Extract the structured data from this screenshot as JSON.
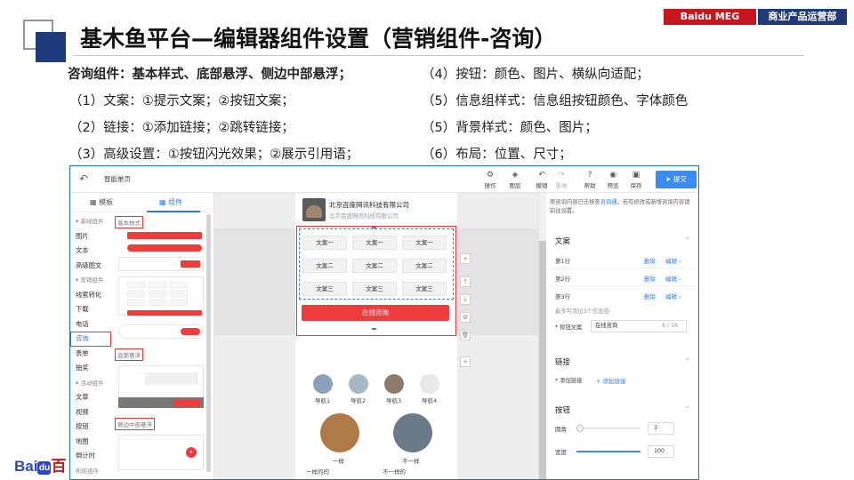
{
  "header": {
    "title": "基木鱼平台—编辑器组件设置（营销组件-咨询）",
    "tag_left": "Baidu MEG",
    "tag_right": "商业产品运营部"
  },
  "bullets": {
    "left": [
      "咨询组件：基本样式、底部悬浮、侧边中部悬浮；",
      "（1）文案：①提示文案；②按钮文案；",
      "（2）链接：①添加链接；②跳转链接；",
      "（3）高级设置：①按钮闪光效果；②展示引用语；"
    ],
    "right": [
      "（4）按钮：颜色、图片、横纵向适配；",
      "（5）信息组样式：信息组按钮颜色、字体颜色",
      "（5）背景样式：颜色、图片；",
      "（6）布局：位置、尺寸；"
    ]
  },
  "logo": {
    "left": "Bai",
    "mid": "du",
    "right": "百"
  },
  "editor": {
    "page_name": "智能单页",
    "toolbar": {
      "operate": "操作",
      "layer": "图层",
      "undo": "撤销",
      "redo": "重做",
      "help": "帮助",
      "preview": "预览",
      "save": "保存",
      "submit": "提交"
    },
    "left_panel": {
      "tab_template": "模板",
      "tab_component": "组件",
      "nav": [
        {
          "label": "基础组件",
          "group": true
        },
        {
          "label": "图片"
        },
        {
          "label": "文本"
        },
        {
          "label": "高级图文"
        },
        {
          "label": "营销组件",
          "group": true
        },
        {
          "label": "线索转化"
        },
        {
          "label": "下载"
        },
        {
          "label": "电话"
        },
        {
          "label": "咨询",
          "selected": true
        },
        {
          "label": "表单"
        },
        {
          "label": "抽奖"
        },
        {
          "label": "活动组件",
          "group": true
        },
        {
          "label": "文章"
        },
        {
          "label": "视频"
        },
        {
          "label": "按钮"
        },
        {
          "label": "地图"
        },
        {
          "label": "倒计时"
        },
        {
          "label": "布局组件",
          "group": true
        }
      ],
      "preview_labels": {
        "basic": "基本样式",
        "bottom": "底部悬浮",
        "side": "侧边中部悬浮"
      }
    },
    "phone": {
      "company": "北京百度网讯科技有限公司",
      "company_sub": "北京百度网讯科技有限公司",
      "grid": [
        [
          "文案一",
          "文案一",
          "文案一"
        ],
        [
          "文案二",
          "文案二",
          "文案二"
        ],
        [
          "文案三",
          "文案三",
          "文案三"
        ]
      ],
      "online_button": "在线咨询",
      "nav_items": [
        "导航1",
        "导航2",
        "导航3",
        "导航4"
      ],
      "big_items": [
        "一样",
        "不一样"
      ],
      "big_subs": [
        "一样的的",
        "不一样的"
      ],
      "phone_label": "电话",
      "consult_label": "咨询"
    },
    "right_panel": {
      "tip_prefix": "原咨询内容已迁移至",
      "tip_link": "咨询通",
      "tip_suffix": "，若有修改或新增咨询内容请前往设置。",
      "copy_section": "文案",
      "rows": [
        {
          "label": "第1行",
          "delete": "删除",
          "edit": "编辑"
        },
        {
          "label": "第2行",
          "delete": "删除",
          "edit": "编辑"
        },
        {
          "label": "第3行",
          "delete": "删除",
          "edit": "编辑"
        }
      ],
      "rows_note": "最多可添加3个信息组",
      "button_copy_label": "按钮文案",
      "button_copy_value": "在线咨询",
      "button_copy_count": "8 / 16",
      "link_section": "链接",
      "add_link": "添加链接",
      "add_link_action": "+ 添加链接",
      "button_section": "按钮",
      "radius_label": "圆角",
      "radius_value": "3",
      "width_label": "宽度",
      "width_value": "100"
    }
  }
}
